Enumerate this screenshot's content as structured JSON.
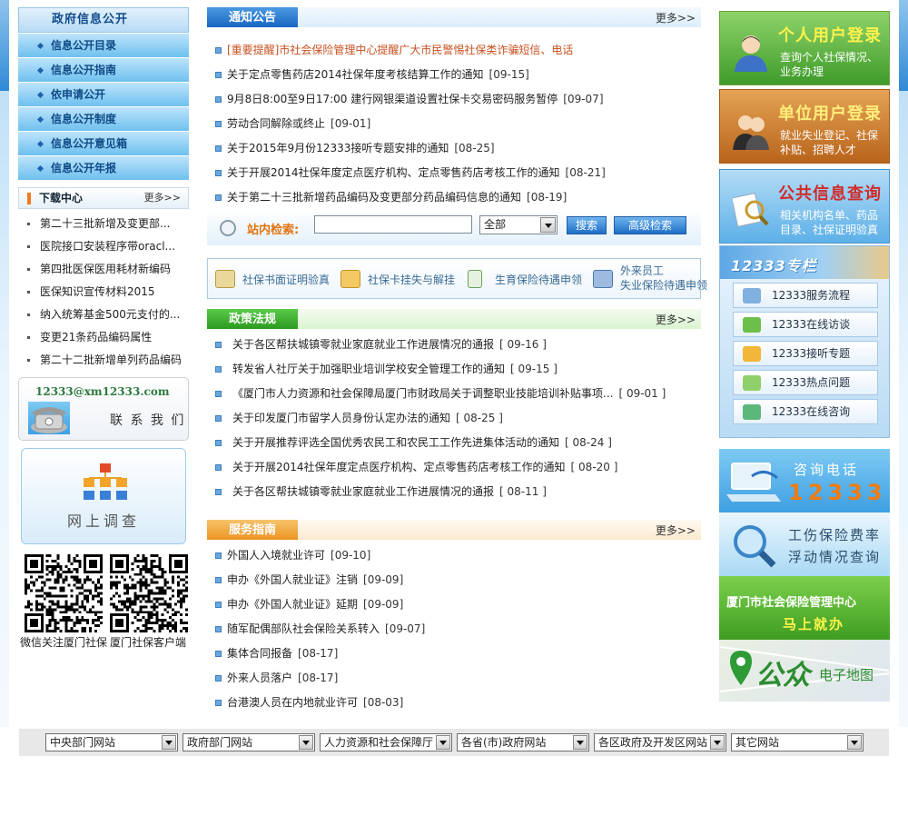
{
  "left": {
    "menu_title": "政府信息公开",
    "menu": [
      "信息公开目录",
      "信息公开指南",
      "依申请公开",
      "信息公开制度",
      "信息公开意见箱",
      "信息公开年报"
    ],
    "download": {
      "title": "下载中心",
      "more": "更多>>",
      "items": [
        "第二十三批新增及变更部...",
        "医院接口安装程序带oracl...",
        "第四批医保医用耗材新编码",
        "医保知识宣传材料2015",
        "纳入统筹基金500元支付的...",
        "变更21条药品编码属性",
        "第二十二批新增单列药品编码"
      ]
    },
    "contact": {
      "email": "12333@xm12333.com",
      "label": "联 系 我 们"
    },
    "survey": "网上调查",
    "qr": [
      "微信关注厦门社保",
      "厦门社保客户端"
    ]
  },
  "notice": {
    "title": "通知公告",
    "more": "更多>>",
    "items": [
      {
        "text": "[重要提醒]市社会保险管理中心提醒广大市民警惕社保类诈骗短信、电话",
        "date": "",
        "hot": true
      },
      {
        "text": "关于定点零售药店2014社保年度考核结算工作的通知",
        "date": "[09-15]"
      },
      {
        "text": "9月8日8:00至9日17:00 建行网银渠道设置社保卡交易密码服务暂停",
        "date": "[09-07]"
      },
      {
        "text": "劳动合同解除或终止",
        "date": "[09-01]"
      },
      {
        "text": "关于2015年9月份12333接听专题安排的通知",
        "date": "[08-25]"
      },
      {
        "text": "关于开展2014社保年度定点医疗机构、定点零售药店考核工作的通知",
        "date": "[08-21]"
      },
      {
        "text": "关于第二十三批新增药品编码及变更部分药品编码信息的通知",
        "date": "[08-19]"
      }
    ]
  },
  "search": {
    "label": "站内检索:",
    "placeholder": "",
    "scope": "全部",
    "search_btn": "搜索",
    "advanced_btn": "高级检索"
  },
  "quick": [
    "社保书面证明验真",
    "社保卡挂失与解挂",
    "生育保险待遇申领",
    "外来员工失业保险待遇申领"
  ],
  "policy": {
    "title": "政策法规",
    "more": "更多>>",
    "items": [
      {
        "text": "关于各区帮扶城镇零就业家庭就业工作进展情况的通报",
        "date": "[ 09-16 ]"
      },
      {
        "text": "转发省人社厅关于加强职业培训学校安全管理工作的通知",
        "date": "[ 09-15 ]"
      },
      {
        "text": "《厦门市人力资源和社会保障局厦门市财政局关于调整职业技能培训补贴事项...",
        "date": "[ 09-01 ]"
      },
      {
        "text": "关于印发厦门市留学人员身份认定办法的通知",
        "date": "[ 08-25 ]"
      },
      {
        "text": "关于开展推荐评选全国优秀农民工和农民工工作先进集体活动的通知",
        "date": "[ 08-24 ]"
      },
      {
        "text": "关于开展2014社保年度定点医疗机构、定点零售药店考核工作的通知",
        "date": "[ 08-20 ]"
      },
      {
        "text": "关于各区帮扶城镇零就业家庭就业工作进展情况的通报",
        "date": "[ 08-11 ]"
      }
    ]
  },
  "service": {
    "title": "服务指南",
    "more": "更多>>",
    "items": [
      {
        "text": "外国人入境就业许可",
        "date": "[09-10]"
      },
      {
        "text": "申办《外国人就业证》注销",
        "date": "[09-09]"
      },
      {
        "text": "申办《外国人就业证》延期",
        "date": "[09-09]"
      },
      {
        "text": "随军配偶部队社会保险关系转入",
        "date": "[09-07]"
      },
      {
        "text": "集体合同报备",
        "date": "[08-17]"
      },
      {
        "text": "外来人员落户",
        "date": "[08-17]"
      },
      {
        "text": "台港澳人员在内地就业许可",
        "date": "[08-03]"
      }
    ]
  },
  "right": {
    "personal": {
      "title": "个人用户登录",
      "sub1": "查询个人社保情况、",
      "sub2": "业务办理"
    },
    "unit": {
      "title": "单位用户登录",
      "sub1": "就业失业登记、社保",
      "sub2": "补贴、招聘人才"
    },
    "public": {
      "title": "公共信息查询",
      "sub1": "相关机构名单、药品",
      "sub2": "目录、社保证明验真"
    },
    "p12333": {
      "title": "12333专栏",
      "items": [
        "12333服务流程",
        "12333在线访谈",
        "12333接听专题",
        "12333热点问题",
        "12333在线咨询"
      ]
    },
    "hotline": {
      "label": "咨询电话",
      "number": "12333"
    },
    "rate": {
      "line1": "工伤保险费率",
      "line2": "浮动情况查询"
    },
    "center": {
      "line1": "厦门市社会保险管理中心",
      "line2": "马上就办"
    },
    "map": {
      "big": "公众",
      "small": "电子地图"
    }
  },
  "bottom": [
    "中央部门网站",
    "政府部门网站",
    "人力资源和社会保障厅",
    "各省(市)政府网站",
    "各区政府及开发区网站",
    "其它网站"
  ],
  "colors": {
    "accent": "#1766c3",
    "green": "#2c9a1f",
    "orange": "#ec9422",
    "hot_text": "#c7501f"
  }
}
